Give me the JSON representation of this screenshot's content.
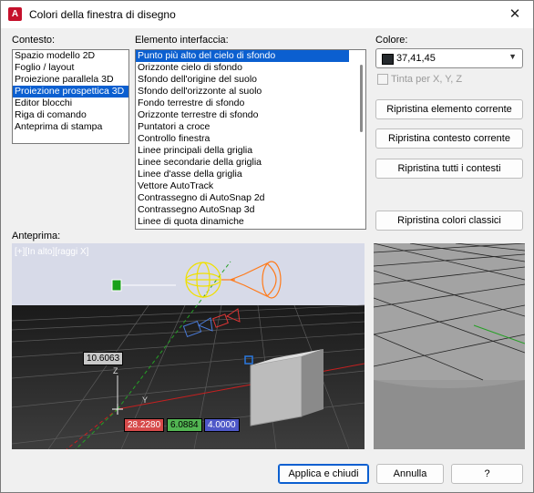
{
  "title": "Colori della finestra di disegno",
  "labels": {
    "contesto": "Contesto:",
    "elemento": "Elemento interfaccia:",
    "colore": "Colore:",
    "anteprima": "Anteprima:"
  },
  "contexts": [
    "Spazio modello 2D",
    "Foglio / layout",
    "Proiezione parallela 3D",
    "Proiezione prospettica 3D",
    "Editor blocchi",
    "Riga di comando",
    "Anteprima di stampa"
  ],
  "elements": [
    "Punto più alto del cielo di sfondo",
    "Orizzonte cielo di sfondo",
    "Sfondo dell'origine del suolo",
    "Sfondo dell'orizzonte al suolo",
    "Fondo terrestre di sfondo",
    "Orizzonte terrestre di sfondo",
    "Puntatori a croce",
    "Controllo finestra",
    "Linee principali della griglia",
    "Linee secondarie della griglia",
    "Linee d'asse della griglia",
    "Vettore AutoTrack",
    "Contrassegno di AutoSnap 2d",
    "Contrassegno AutoSnap 3d",
    "Linee di quota dinamiche"
  ],
  "color": {
    "value": "37,41,45",
    "swatch": "#25292d"
  },
  "tint_label": "Tinta per X, Y, Z",
  "buttons": {
    "restore_element": "Ripristina elemento corrente",
    "restore_context": "Ripristina contesto corrente",
    "restore_all": "Ripristina tutti i contesti",
    "restore_classic": "Ripristina colori classici",
    "apply": "Applica e chiudi",
    "cancel": "Annulla",
    "help": "?"
  },
  "preview": {
    "viewport_label": "[+][In alto][raggi X]",
    "dim_value": "10.6063",
    "coord_x": "28.2280",
    "coord_y": "6.0884",
    "coord_z": "4.0000",
    "axis_z": "Z",
    "axis_y": "Y"
  }
}
